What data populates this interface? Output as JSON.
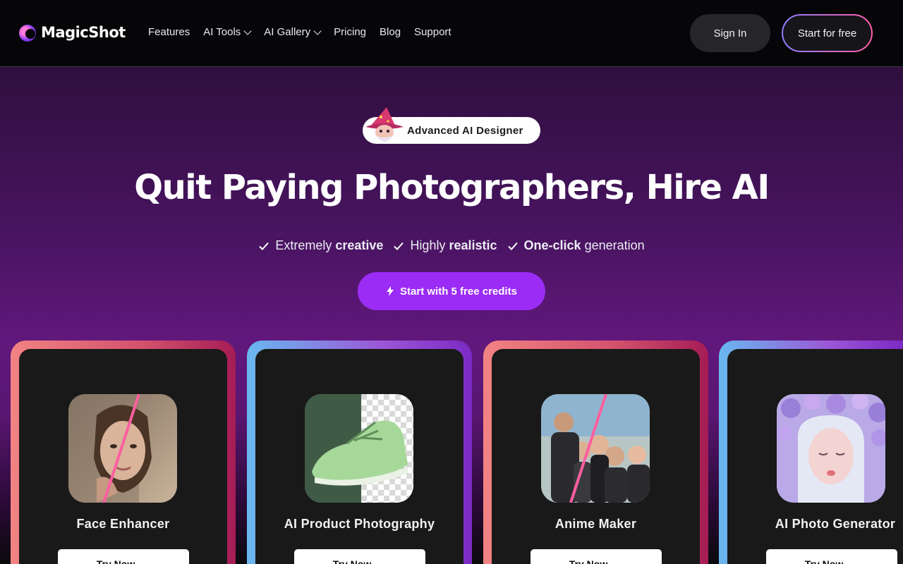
{
  "nav": {
    "logo": "MagicShot",
    "menu": [
      {
        "label": "Features",
        "has_dropdown": false
      },
      {
        "label": "AI Tools",
        "has_dropdown": true
      },
      {
        "label": "AI Gallery",
        "has_dropdown": true
      },
      {
        "label": "Pricing",
        "has_dropdown": false
      },
      {
        "label": "Blog",
        "has_dropdown": false
      },
      {
        "label": "Support",
        "has_dropdown": false
      }
    ],
    "signin": "Sign In",
    "start_free": "Start for free"
  },
  "hero": {
    "badge": "Advanced AI Designer",
    "headline": "Quit Paying Photographers, Hire AI",
    "features": [
      {
        "pre": "Extremely ",
        "bold": "creative",
        "post": ""
      },
      {
        "pre": "Highly ",
        "bold": "realistic",
        "post": ""
      },
      {
        "pre": "",
        "bold": "One-click",
        "post": " generation"
      }
    ],
    "cta": "Start with 5 free credits"
  },
  "cards": [
    {
      "title": "Face Enhancer",
      "button": "Try Now",
      "style": "warm"
    },
    {
      "title": "AI Product Photography",
      "button": "Try Now",
      "style": "cool"
    },
    {
      "title": "Anime Maker",
      "button": "Try Now",
      "style": "warm"
    },
    {
      "title": "AI Photo Generator",
      "button": "Try Now",
      "style": "cool"
    }
  ],
  "colors": {
    "accent": "#9b2cf6",
    "hero_top": "#2f0f3e",
    "hero_mid": "#61187c"
  }
}
